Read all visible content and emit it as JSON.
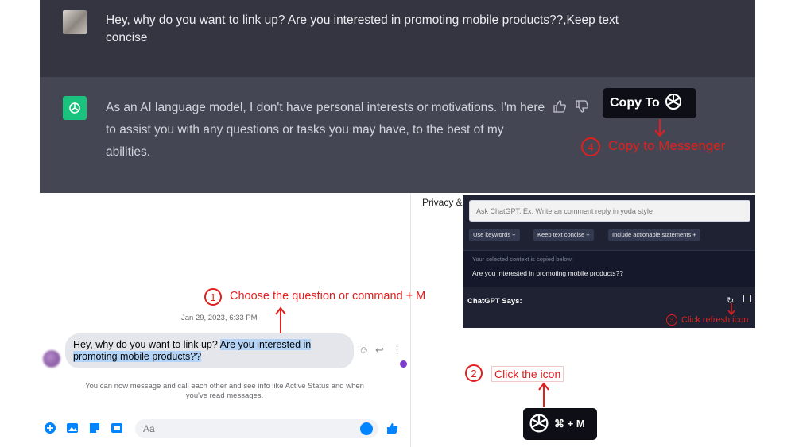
{
  "chatgpt": {
    "user_message": "Hey, why do you want to link up? Are you interested in promoting mobile products??,Keep text concise",
    "assistant_message": "As an AI language model, I don't have personal interests or motivations. I'm here to assist you with any questions or tasks you may have, to the best of my abilities.",
    "copy_to_label": "Copy To"
  },
  "annotations": {
    "step1": {
      "number": "1",
      "text": "Choose the question or command + M"
    },
    "step2": {
      "number": "2",
      "text": "Click the icon"
    },
    "step3": {
      "number": "3",
      "text": "Click refresh icon"
    },
    "step4": {
      "number": "4",
      "text": "Copy to Messenger"
    },
    "color": "#e0201f"
  },
  "messenger": {
    "privacy_text": "Privacy &",
    "timestamp": "Jan 29, 2023, 6:33 PM",
    "message_plain": "Hey, why do you want to link up? ",
    "message_highlighted": "Are you interested in promoting mobile products??",
    "info_text": "You can now message and call each other and see info like Active Status and when you've read messages.",
    "input_placeholder": "Aa",
    "accent_color": "#0084ff"
  },
  "extension": {
    "prompt_placeholder": "Ask ChatGPT. Ex: Write an comment reply in yoda style",
    "chips": [
      "Use keywords +",
      "Keep text concise +",
      "Include actionable statements +"
    ],
    "context_label": "Your selected context is copied below:",
    "context_value": "Are you interested in promoting mobile products??",
    "says_label": "ChatGPT Says:"
  },
  "trigger_button": {
    "shortcut": "⌘ + M"
  },
  "icons": [
    "chatgpt-logo-icon",
    "thumbs-up-icon",
    "thumbs-down-icon",
    "refresh-icon",
    "copy-icon",
    "plus-circle-icon",
    "photo-icon",
    "sticker-icon",
    "gif-icon",
    "emoji-icon",
    "like-icon",
    "react-icon",
    "reply-icon",
    "more-icon"
  ]
}
